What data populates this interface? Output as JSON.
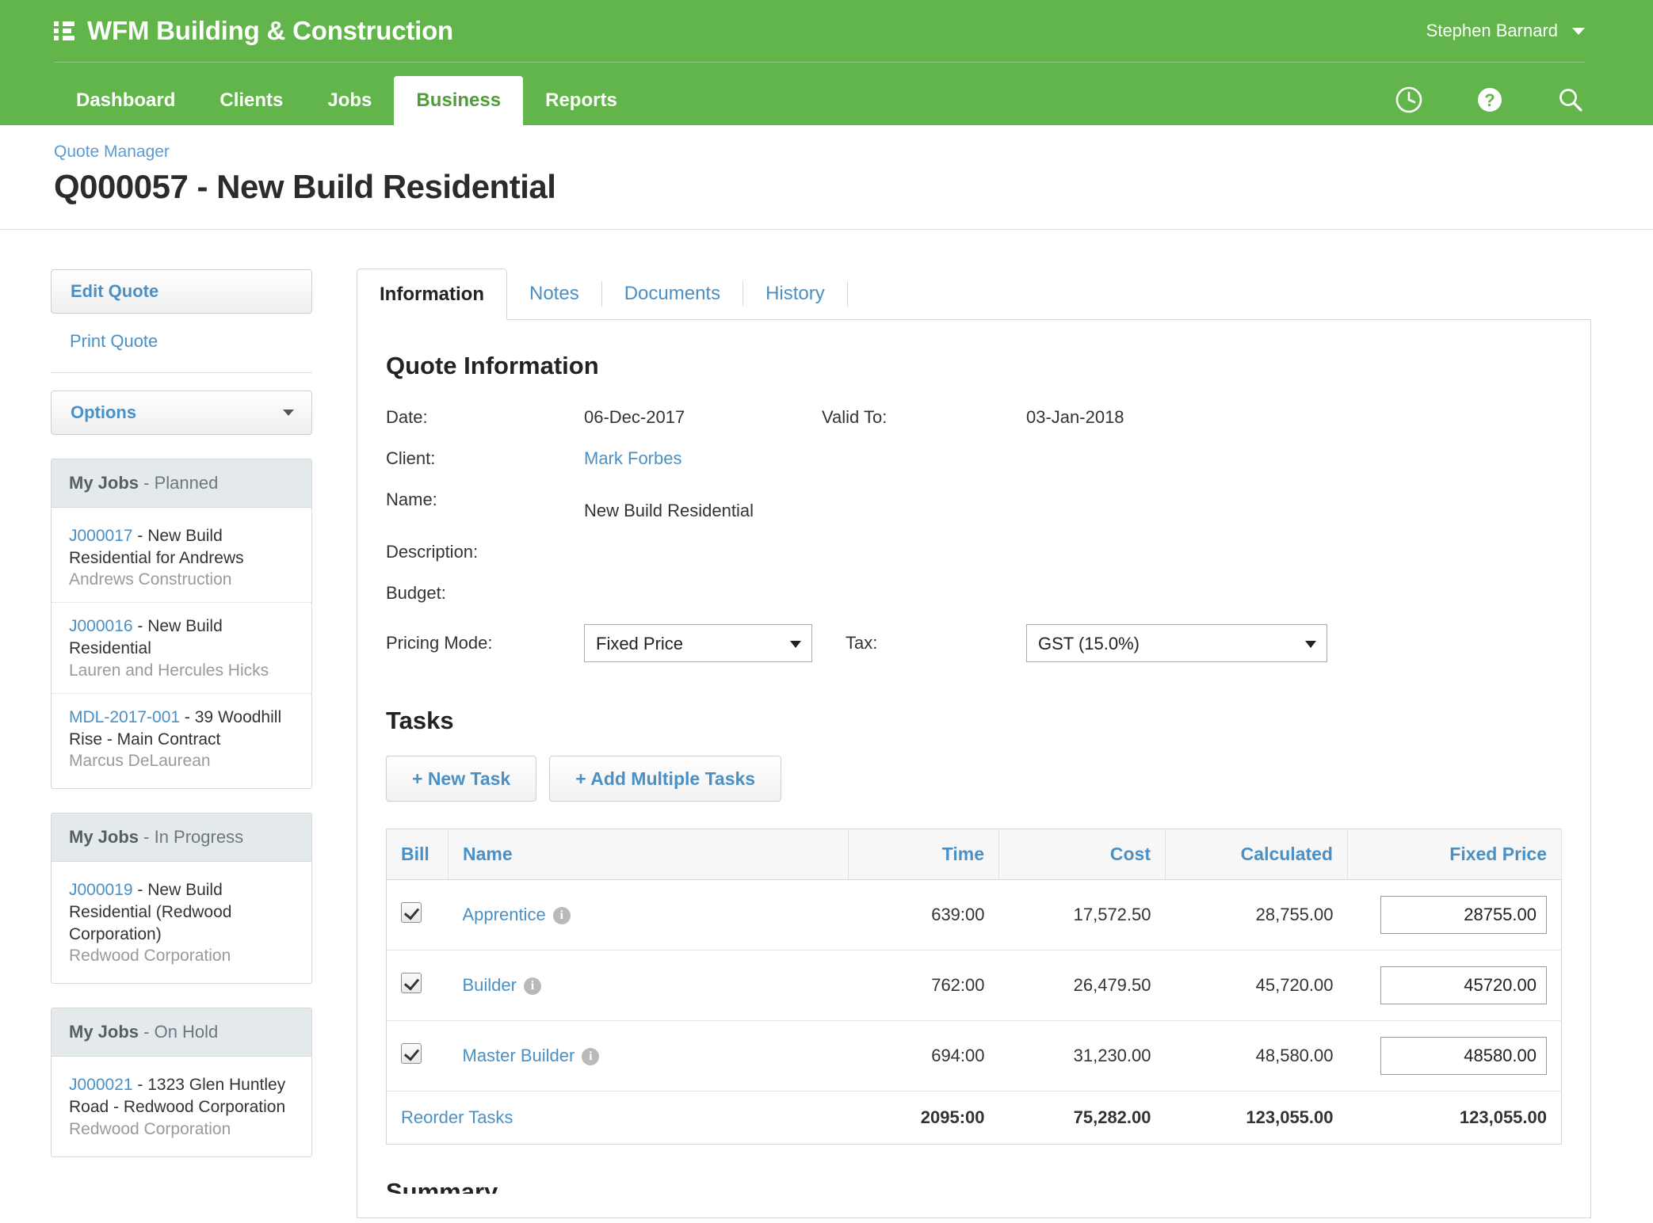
{
  "app": {
    "brand": "WFM Building & Construction",
    "list_icon": "list-icon",
    "accent_green": "#62b54a",
    "link_blue": "#4a90c4"
  },
  "header": {
    "user_name": "Stephen Barnard",
    "user_caret": "chevron-down-icon",
    "nav": [
      {
        "label": "Dashboard",
        "active": false
      },
      {
        "label": "Clients",
        "active": false
      },
      {
        "label": "Jobs",
        "active": false
      },
      {
        "label": "Business",
        "active": true
      },
      {
        "label": "Reports",
        "active": false
      }
    ],
    "icons": [
      {
        "name": "clock-icon"
      },
      {
        "name": "help-icon"
      },
      {
        "name": "search-icon"
      }
    ]
  },
  "page": {
    "breadcrumb": "Quote Manager",
    "title": "Q000057 - New Build Residential"
  },
  "sidebar": {
    "edit_quote": "Edit Quote",
    "print_quote": "Print Quote",
    "options": "Options",
    "options_caret": "chevron-down-icon",
    "panels": [
      {
        "title_main": "My Jobs",
        "title_sub": " - Planned",
        "jobs": [
          {
            "id": "J000017",
            "name": " - New Build Residential for Andrews",
            "client": "Andrews Construction"
          },
          {
            "id": "J000016",
            "name": " - New Build Residential",
            "client": "Lauren and Hercules Hicks"
          },
          {
            "id": "MDL-2017-001",
            "name": " - 39 Woodhill Rise - Main Contract",
            "client": "Marcus DeLaurean"
          }
        ]
      },
      {
        "title_main": "My Jobs",
        "title_sub": " - In Progress",
        "jobs": [
          {
            "id": "J000019",
            "name": " - New Build Residential (Redwood Corporation)",
            "client": "Redwood Corporation"
          }
        ]
      },
      {
        "title_main": "My Jobs",
        "title_sub": " - On Hold",
        "jobs": [
          {
            "id": "J000021",
            "name": " - 1323 Glen Huntley Road - Redwood Corporation",
            "client": "Redwood Corporation"
          }
        ]
      }
    ]
  },
  "tabs": [
    {
      "label": "Information",
      "active": true
    },
    {
      "label": "Notes",
      "active": false
    },
    {
      "label": "Documents",
      "active": false
    },
    {
      "label": "History",
      "active": false
    }
  ],
  "quote_information": {
    "section_title": "Quote Information",
    "date_label": "Date:",
    "date_value": "06-Dec-2017",
    "valid_to_label": "Valid To:",
    "valid_to_value": "03-Jan-2018",
    "client_label": "Client:",
    "client_value": "Mark Forbes",
    "name_label": "Name:",
    "name_value": "New Build Residential",
    "description_label": "Description:",
    "description_value": "",
    "budget_label": "Budget:",
    "budget_value": "",
    "pricing_mode_label": "Pricing Mode:",
    "pricing_mode_value": "Fixed Price",
    "pricing_mode_options": [
      "Fixed Price"
    ],
    "tax_label": "Tax:",
    "tax_value": "GST (15.0%)",
    "tax_options": [
      "GST (15.0%)"
    ]
  },
  "tasks": {
    "section_title": "Tasks",
    "new_task_label": "+ New Task",
    "add_multiple_label": "+ Add Multiple Tasks",
    "columns": [
      "Bill",
      "Name",
      "Time",
      "Cost",
      "Calculated",
      "Fixed Price"
    ],
    "rows": [
      {
        "bill_checked": true,
        "name": "Apprentice",
        "time": "639:00",
        "cost": "17,572.50",
        "calculated": "28,755.00",
        "fixed_price": "28755.00"
      },
      {
        "bill_checked": true,
        "name": "Builder",
        "time": "762:00",
        "cost": "26,479.50",
        "calculated": "45,720.00",
        "fixed_price": "45720.00"
      },
      {
        "bill_checked": true,
        "name": "Master Builder",
        "time": "694:00",
        "cost": "31,230.00",
        "calculated": "48,580.00",
        "fixed_price": "48580.00"
      }
    ],
    "footer": {
      "reorder_label": "Reorder Tasks",
      "time_total": "2095:00",
      "cost_total": "75,282.00",
      "calculated_total": "123,055.00",
      "fixed_price_total": "123,055.00"
    }
  },
  "below_fold": {
    "partial_heading": "Summary"
  }
}
